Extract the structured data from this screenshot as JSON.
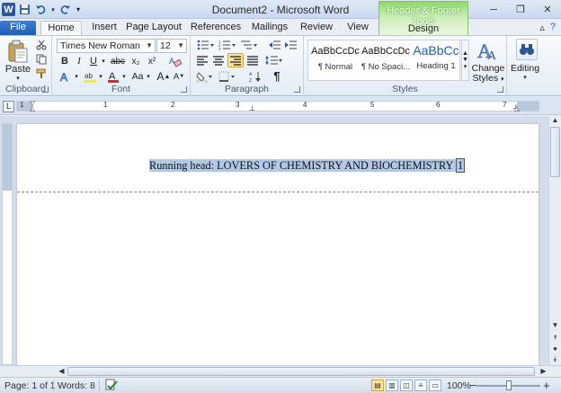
{
  "window": {
    "title": "Document2 - Microsoft Word",
    "controls": {
      "minimize": "─",
      "restore": "❐",
      "close": "✕"
    }
  },
  "qat": {
    "logo": "W",
    "save": "💾",
    "undo": "↶",
    "redo": "↻"
  },
  "contextual": {
    "group": "Header & Footer Tools",
    "tab": "Design"
  },
  "tabs": {
    "file": "File",
    "home": "Home",
    "insert": "Insert",
    "page_layout": "Page Layout",
    "references": "References",
    "mailings": "Mailings",
    "review": "Review",
    "view": "View"
  },
  "ribbon": {
    "clipboard": {
      "label": "Clipboard",
      "paste": "Paste"
    },
    "font": {
      "label": "Font",
      "font_name": "Times New Roman",
      "font_size": "12",
      "bold": "B",
      "italic": "I",
      "underline": "U",
      "strike": "abc",
      "subscript": "x₂",
      "superscript": "x²",
      "grow": "A",
      "shrink": "A",
      "case": "Aa"
    },
    "paragraph": {
      "label": "Paragraph",
      "pilcrow": "¶"
    },
    "styles": {
      "label": "Styles",
      "items": [
        {
          "sample": "AaBbCcDc",
          "name": "¶ Normal"
        },
        {
          "sample": "AaBbCcDc",
          "name": "¶ No Spaci..."
        },
        {
          "sample": "AaBbCc",
          "name": "Heading 1"
        }
      ],
      "change_styles": "Change Styles",
      "change_styles_line1": "Change",
      "change_styles_line2": "Styles"
    },
    "editing": {
      "label": "Editing"
    }
  },
  "ruler": {
    "numbers": [
      "1",
      "1",
      "2",
      "3",
      "4",
      "5",
      "6",
      "7"
    ]
  },
  "document": {
    "header_text": "Running head: LOVERS OF CHEMISTRY AND BIOCHEMISTRY",
    "page_number": "1"
  },
  "status": {
    "page": "Page: 1 of 1",
    "words": "Words: 8",
    "zoom": "100%",
    "zoom_minus": "−",
    "zoom_plus": "+"
  },
  "colors": {
    "file_tab": "#2b62b8",
    "contextual_green": "#8fd86b",
    "selection": "#b3c8e6",
    "font_color_bar": "#e8211a",
    "highlight_bar": "#ffee00"
  }
}
